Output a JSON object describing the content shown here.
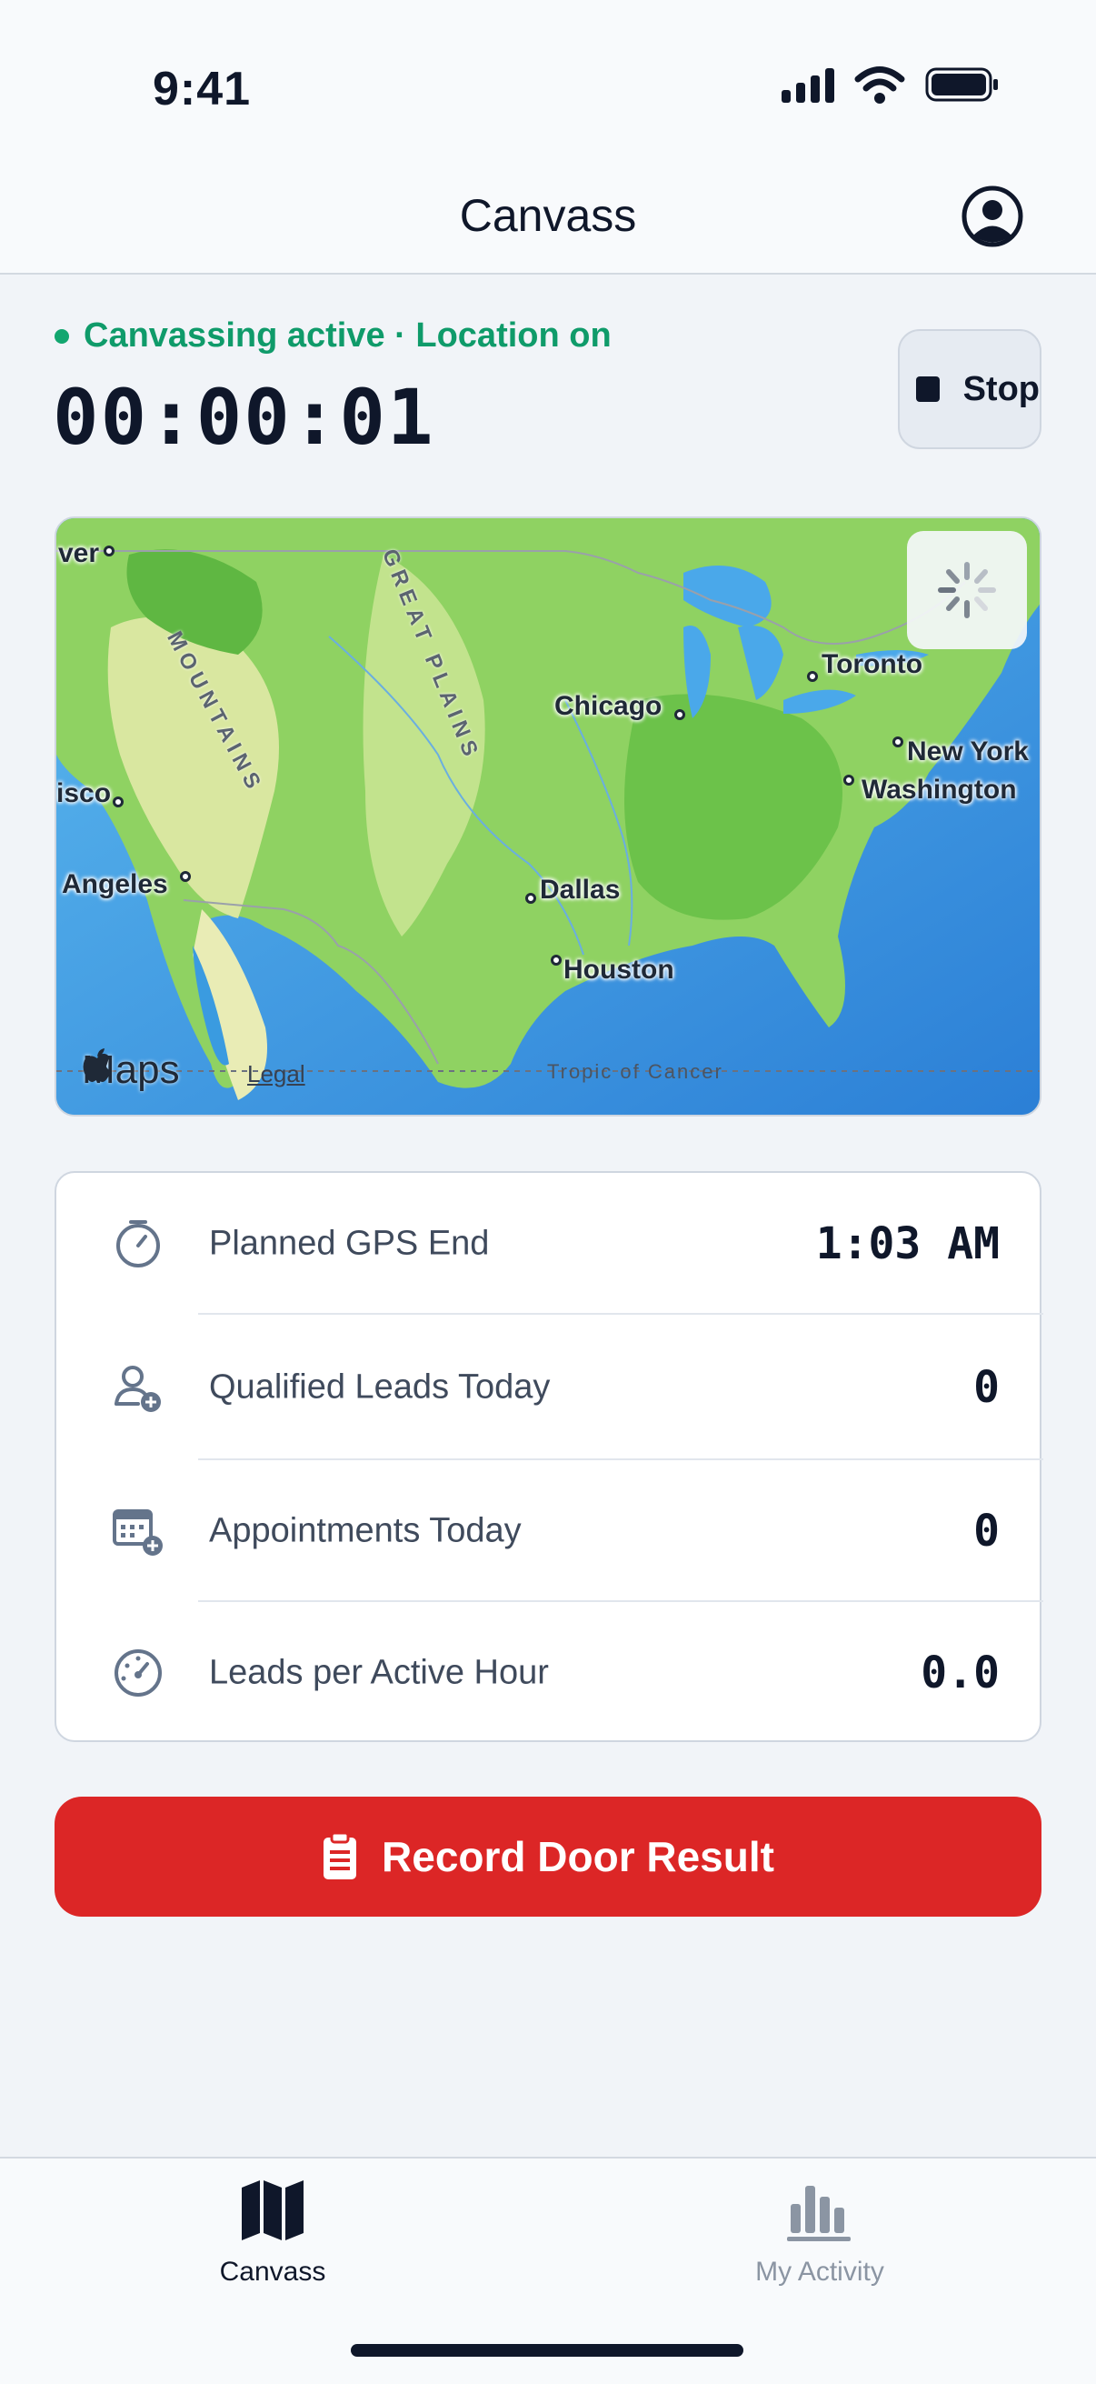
{
  "status_bar": {
    "time": "9:41"
  },
  "header": {
    "title": "Canvass"
  },
  "session": {
    "status": "Canvassing active · Location on",
    "timer": "00:00:01",
    "stop_label": "Stop"
  },
  "map": {
    "cities": {
      "denver": "ver",
      "chicago": "Chicago",
      "toronto": "Toronto",
      "new_york": "New York",
      "washington": "Washington",
      "san_francisco": "isco",
      "los_angeles": "Angeles",
      "dallas": "Dallas",
      "houston": "Houston"
    },
    "regions": {
      "mountains": "MOUNTAINS",
      "great_plains": "GREAT PLAINS"
    },
    "brand": "Maps",
    "legal": "Legal",
    "tropic": "Tropic of Cancer"
  },
  "stats": [
    {
      "icon": "timer-icon",
      "label": "Planned GPS End",
      "value": "1:03 AM"
    },
    {
      "icon": "person-add-icon",
      "label": "Qualified Leads Today",
      "value": "0"
    },
    {
      "icon": "calendar-add-icon",
      "label": "Appointments Today",
      "value": "0"
    },
    {
      "icon": "gauge-icon",
      "label": "Leads per Active Hour",
      "value": "0.0"
    }
  ],
  "cta": {
    "label": "Record Door Result"
  },
  "tabs": [
    {
      "label": "Canvass",
      "active": true
    },
    {
      "label": "My Activity",
      "active": false
    }
  ],
  "colors": {
    "accent_green": "#0f9b6a",
    "cta_red": "#dc2626",
    "ink": "#0f172a",
    "inactive": "#8b95a3"
  }
}
